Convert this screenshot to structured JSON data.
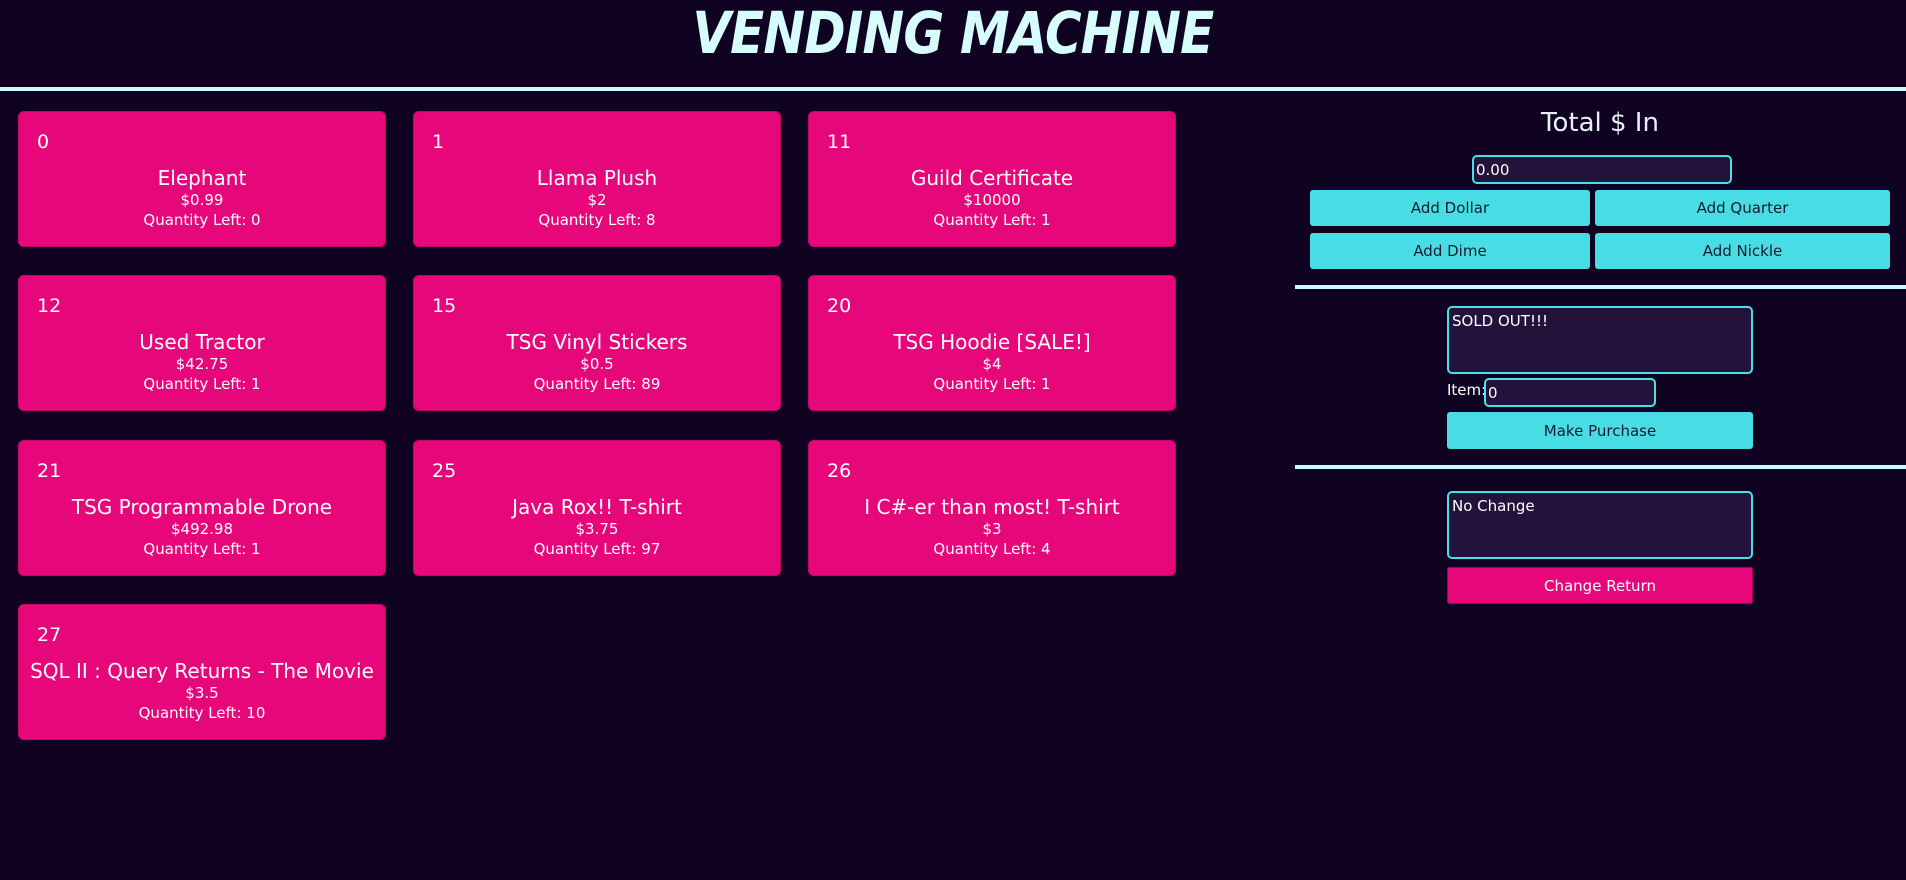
{
  "header": {
    "title": "VENDING MACHINE"
  },
  "items": [
    {
      "id": "0",
      "name": "Elephant",
      "price": "$0.99",
      "qty_label": "Quantity Left:",
      "qty": "0"
    },
    {
      "id": "1",
      "name": "Llama Plush",
      "price": "$2",
      "qty_label": "Quantity Left:",
      "qty": "8"
    },
    {
      "id": "11",
      "name": "Guild Certificate",
      "price": "$10000",
      "qty_label": "Quantity Left:",
      "qty": "1"
    },
    {
      "id": "12",
      "name": "Used Tractor",
      "price": "$42.75",
      "qty_label": "Quantity Left:",
      "qty": "1"
    },
    {
      "id": "15",
      "name": "TSG Vinyl Stickers",
      "price": "$0.5",
      "qty_label": "Quantity Left:",
      "qty": "89"
    },
    {
      "id": "20",
      "name": "TSG Hoodie [SALE!]",
      "price": "$4",
      "qty_label": "Quantity Left:",
      "qty": "1"
    },
    {
      "id": "21",
      "name": "TSG Programmable Drone",
      "price": "$492.98",
      "qty_label": "Quantity Left:",
      "qty": "1"
    },
    {
      "id": "25",
      "name": "Java Rox!! T-shirt",
      "price": "$3.75",
      "qty_label": "Quantity Left:",
      "qty": "97"
    },
    {
      "id": "26",
      "name": "I C#-er than most! T-shirt",
      "price": "$3",
      "qty_label": "Quantity Left:",
      "qty": "4"
    },
    {
      "id": "27",
      "name": "SQL II : Query Returns - The Movie",
      "price": "$3.5",
      "qty_label": "Quantity Left:",
      "qty": "10"
    }
  ],
  "money": {
    "heading": "Total $ In",
    "total_value": "0.00",
    "add_dollar": "Add Dollar",
    "add_quarter": "Add Quarter",
    "add_dime": "Add Dime",
    "add_nickle": "Add Nickle"
  },
  "purchase": {
    "message": "SOLD OUT!!!",
    "item_label": "Item:",
    "item_value": "0",
    "make_purchase": "Make Purchase"
  },
  "change": {
    "message": "No Change",
    "change_return": "Change Return"
  },
  "colors": {
    "background": "#0f0321",
    "card": "#e6077a",
    "accent_cyan": "#48dde4",
    "title": "#d6fdfc"
  }
}
